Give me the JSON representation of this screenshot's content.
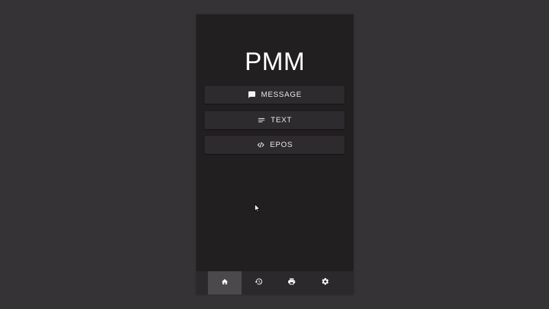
{
  "app": {
    "title": "PMM"
  },
  "menu": {
    "items": [
      {
        "label": "MESSAGE",
        "icon": "message-icon"
      },
      {
        "label": "TEXT",
        "icon": "text-lines-icon"
      },
      {
        "label": "EPOS",
        "icon": "code-icon"
      }
    ]
  },
  "bottom_nav": {
    "items": [
      {
        "icon": "home-icon",
        "active": true
      },
      {
        "icon": "history-icon",
        "active": false
      },
      {
        "icon": "print-icon",
        "active": false
      },
      {
        "icon": "settings-icon",
        "active": false
      }
    ]
  },
  "colors": {
    "desktop_background": "#353335",
    "app_background": "#221f21",
    "button_background": "#2e2b2e",
    "nav_background": "#2c292c",
    "nav_active": "#4b494b",
    "text": "#ffffff"
  }
}
